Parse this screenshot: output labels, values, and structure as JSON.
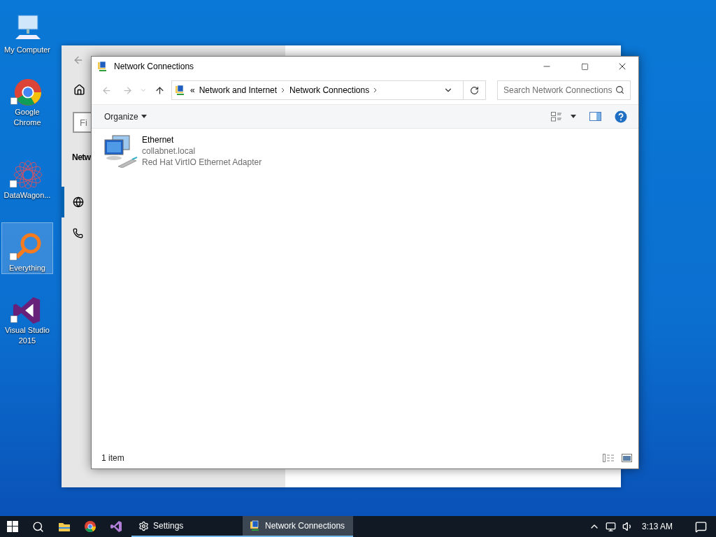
{
  "desktop_icons": [
    {
      "kind": "computer",
      "label": "My Computer",
      "selected": false
    },
    {
      "kind": "chrome",
      "label": "Google Chrome",
      "selected": false
    },
    {
      "kind": "datawagon",
      "label": "DataWagon...",
      "selected": false
    },
    {
      "kind": "everything",
      "label": "Everything",
      "selected": true
    },
    {
      "kind": "studio",
      "label": "Visual Studio 2015",
      "selected": false
    }
  ],
  "settings_window": {
    "search_field": {
      "value": "Fi"
    },
    "heading": "Netw",
    "nav_items": [
      {
        "kind": "globe",
        "selected": true
      },
      {
        "kind": "phone",
        "selected": false
      }
    ]
  },
  "explorer_window": {
    "title": "Network Connections",
    "address_bar": {
      "overflow": "«",
      "crumbs": [
        "Network and Internet",
        "Network Connections"
      ]
    },
    "search": {
      "placeholder": "Search Network Connections"
    },
    "command_bar": {
      "organize": "Organize"
    },
    "items": [
      {
        "name": "Ethernet",
        "lines": [
          "collabnet.local",
          "Red Hat VirtIO Ethernet Adapter"
        ]
      }
    ],
    "status_bar": {
      "count": "1 item"
    }
  },
  "taskbar": {
    "pinned": [
      {
        "kind": "start"
      },
      {
        "kind": "search"
      },
      {
        "kind": "explorer"
      },
      {
        "kind": "chrome"
      },
      {
        "kind": "studio"
      }
    ],
    "running": [
      {
        "kind": "settings",
        "label": "Settings",
        "selected": false
      },
      {
        "kind": "network",
        "label": "Network Connections",
        "selected": true
      }
    ],
    "clock": "3:13 AM"
  }
}
